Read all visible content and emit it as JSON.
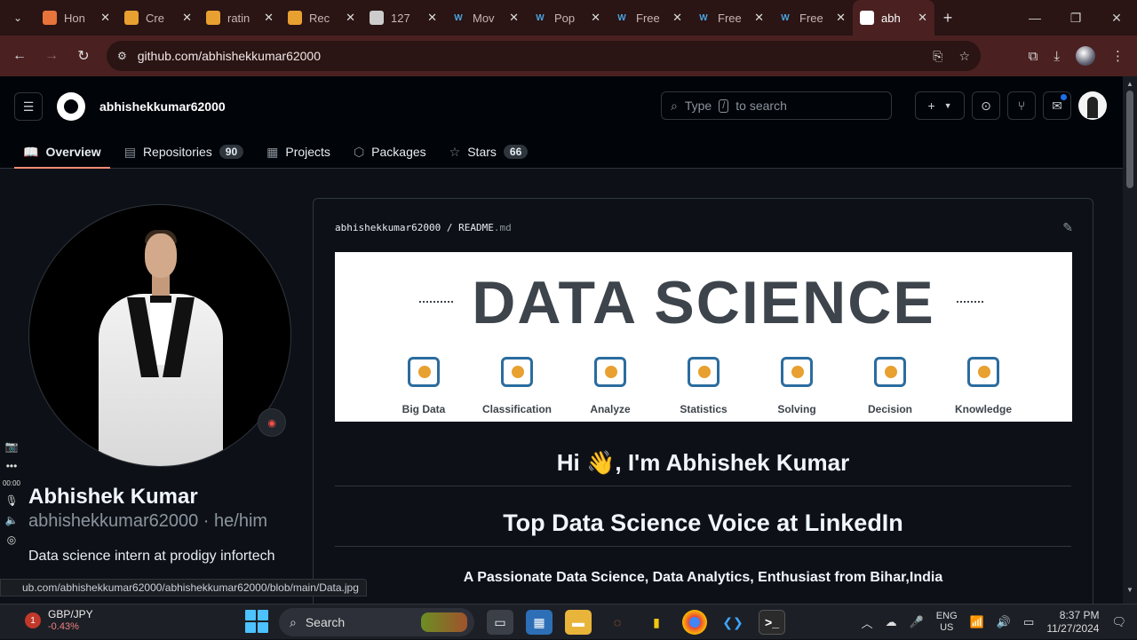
{
  "browser": {
    "tabs": [
      {
        "label": "Hon",
        "favicon": "codeforces-icon",
        "color": "#e8743b"
      },
      {
        "label": "Cre",
        "favicon": "slides-icon",
        "color": "#e8a030"
      },
      {
        "label": "ratin",
        "favicon": "document-icon",
        "color": "#e8a030"
      },
      {
        "label": "Rec",
        "favicon": "slides-icon",
        "color": "#e8a030"
      },
      {
        "label": "127",
        "favicon": "globe-icon",
        "color": "#cccccc"
      },
      {
        "label": "Mov",
        "favicon": "streamlit-icon",
        "color": "#4aa3df"
      },
      {
        "label": "Pop",
        "favicon": "streamlit-icon",
        "color": "#4aa3df"
      },
      {
        "label": "Free",
        "favicon": "streamlit-icon",
        "color": "#4aa3df"
      },
      {
        "label": "Free",
        "favicon": "streamlit-icon",
        "color": "#4aa3df"
      },
      {
        "label": "Free",
        "favicon": "streamlit-icon",
        "color": "#4aa3df"
      },
      {
        "label": "abh",
        "favicon": "github-icon",
        "color": "#ffffff",
        "active": true
      }
    ],
    "url": "github.com/abhishekkumar62000",
    "status_url": "ub.com/abhishekkumar62000/abhishekkumar62000/blob/main/Data.jpg"
  },
  "github": {
    "username": "abhishekkumar62000",
    "search_placeholder_before": "Type",
    "search_key": "/",
    "search_placeholder_after": "to search",
    "nav": [
      {
        "label": "Overview",
        "icon": "book-icon",
        "count": null,
        "selected": true
      },
      {
        "label": "Repositories",
        "icon": "repo-icon",
        "count": "90"
      },
      {
        "label": "Projects",
        "icon": "table-icon",
        "count": null
      },
      {
        "label": "Packages",
        "icon": "package-icon",
        "count": null
      },
      {
        "label": "Stars",
        "icon": "star-icon",
        "count": "66"
      }
    ]
  },
  "profile": {
    "full_name": "Abhishek Kumar",
    "handle": "abhishekkumar62000 · he/him",
    "bio": "Data science intern at prodigy infortech"
  },
  "readme": {
    "path_user": "abhishekkumar62000",
    "path_sep": "/",
    "path_file": "README",
    "path_ext": ".md",
    "banner_title": "DATA SCIENCE",
    "banner_items": [
      "Big Data",
      "Classification",
      "Analyze",
      "Statistics",
      "Solving",
      "Decision",
      "Knowledge"
    ],
    "greeting": "Hi 👋, I'm Abhishek Kumar",
    "headline": "Top Data Science Voice at LinkedIn",
    "tagline": "A Passionate Data Science, Data Analytics, Enthusiast from Bihar,India"
  },
  "taskbar": {
    "ticker_name": "GBP/JPY",
    "ticker_change": "-0.43%",
    "ticker_badge": "1",
    "search_label": "Search",
    "lang_top": "ENG",
    "lang_bottom": "US",
    "time": "8:37 PM",
    "date": "11/27/2024"
  },
  "side_tools": {
    "timer": "00:00"
  }
}
